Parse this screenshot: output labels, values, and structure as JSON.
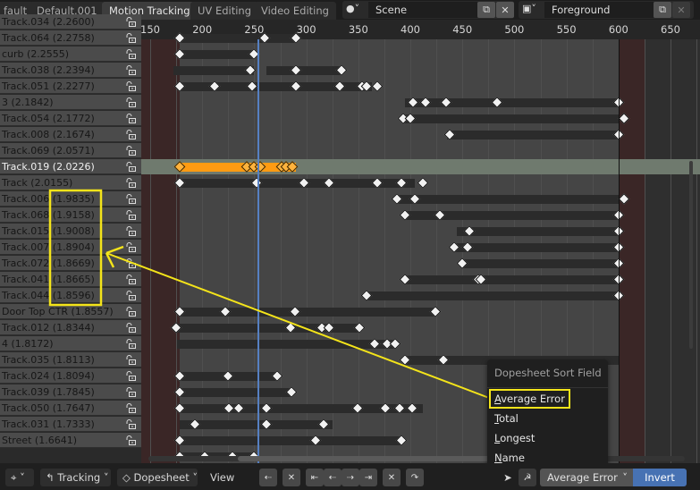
{
  "workspace_tabs": [
    {
      "label": "fault",
      "active": false
    },
    {
      "label": "Default.001",
      "active": false
    },
    {
      "label": "Motion Tracking",
      "active": true
    },
    {
      "label": "UV Editing",
      "active": false
    },
    {
      "label": "Video Editing",
      "active": false
    }
  ],
  "scene": {
    "icon": "scene-icon",
    "value": "Scene"
  },
  "view_layer": {
    "icon": "view-layer-icon",
    "value": "Foreground"
  },
  "timeline": {
    "ruler_ticks": [
      150,
      200,
      250,
      300,
      350,
      400,
      450,
      500,
      550,
      600,
      650
    ],
    "frame_start": 178,
    "frame_end": 600,
    "current_frame": 253
  },
  "tracks": [
    {
      "name": "Track.034 (2.2600)",
      "segments": [],
      "keys": [],
      "partial": true
    },
    {
      "name": "Track.064 (2.2758)",
      "segments": [
        [
          178,
          290
        ]
      ],
      "keys": [
        178,
        260,
        290
      ]
    },
    {
      "name": "curb (2.2555)",
      "segments": [
        [
          178,
          250
        ]
      ],
      "keys": [
        178,
        250
      ]
    },
    {
      "name": "Track.038 (2.2394)",
      "segments": [
        [
          172,
          250
        ],
        [
          262,
          334
        ]
      ],
      "keys": [
        246,
        290,
        334
      ]
    },
    {
      "name": "Track.051 (2.2277)",
      "segments": [
        [
          178,
          363
        ]
      ],
      "keys": [
        178,
        212,
        248,
        290,
        332,
        354,
        358,
        368
      ]
    },
    {
      "name": "3 (2.1842)",
      "segments": [
        [
          395,
          600
        ]
      ],
      "keys": [
        403,
        415,
        434,
        483,
        600
      ]
    },
    {
      "name": "Track.054 (2.1772)",
      "segments": [
        [
          393,
          600
        ]
      ],
      "keys": [
        393,
        400,
        605
      ]
    },
    {
      "name": "Track.008 (2.1674)",
      "segments": [
        [
          435,
          600
        ]
      ],
      "keys": [
        438,
        600
      ]
    },
    {
      "name": "Track.069 (2.0571)",
      "segments": [],
      "keys": []
    },
    {
      "name": "Track.019 (2.0226)",
      "selected": true,
      "segments": [
        [
          178,
          290
        ]
      ],
      "keys": [
        178,
        243,
        250,
        256,
        276,
        281,
        287
      ]
    },
    {
      "name": "Track (2.0155)",
      "segments": [
        [
          178,
          404
        ]
      ],
      "keys": [
        178,
        252,
        298,
        322,
        368,
        391,
        412
      ]
    },
    {
      "name": "Track.006 (1.9835)",
      "segments": [
        [
          387,
          600
        ]
      ],
      "keys": [
        387,
        404,
        605
      ]
    },
    {
      "name": "Track.068 (1.9158)",
      "segments": [
        [
          395,
          600
        ]
      ],
      "keys": [
        395,
        428,
        600
      ]
    },
    {
      "name": "Track.015 (1.9008)",
      "segments": [
        [
          445,
          600
        ]
      ],
      "keys": [
        457,
        600
      ]
    },
    {
      "name": "Track.007 (1.8904)",
      "segments": [
        [
          442,
          600
        ]
      ],
      "keys": [
        442,
        455,
        600
      ]
    },
    {
      "name": "Track.072 (1.8669)",
      "segments": [
        [
          450,
          600
        ]
      ],
      "keys": [
        450,
        600
      ]
    },
    {
      "name": "Track.041 (1.8665)",
      "segments": [
        [
          395,
          600
        ]
      ],
      "keys": [
        395,
        465,
        468,
        600
      ]
    },
    {
      "name": "Track.044 (1.8596)",
      "segments": [
        [
          358,
          600
        ]
      ],
      "keys": [
        358,
        600
      ]
    },
    {
      "name": "Door Top CTR (1.8557)",
      "segments": [
        [
          178,
          424
        ]
      ],
      "keys": [
        178,
        222,
        289,
        424
      ]
    },
    {
      "name": "Track.012 (1.8344)",
      "segments": [
        [
          175,
          351
        ]
      ],
      "keys": [
        175,
        285,
        315,
        322,
        351
      ]
    },
    {
      "name": "4 (1.8172)",
      "segments": [
        [
          176,
          386
        ]
      ],
      "keys": [
        366,
        378,
        385
      ]
    },
    {
      "name": "Track.035 (1.8113)",
      "segments": [
        [
          395,
          600
        ]
      ],
      "keys": [
        395,
        432
      ]
    },
    {
      "name": "Track.024 (1.8094)",
      "segments": [
        [
          178,
          272
        ]
      ],
      "keys": [
        178,
        225,
        272
      ]
    },
    {
      "name": "Track.039 (1.7845)",
      "segments": [
        [
          178,
          286
        ]
      ],
      "keys": [
        178,
        286
      ]
    },
    {
      "name": "Track.050 (1.7647)",
      "segments": [
        [
          178,
          412
        ]
      ],
      "keys": [
        178,
        226,
        235,
        262,
        349,
        376,
        390,
        402
      ]
    },
    {
      "name": "Track.031 (1.7333)",
      "segments": [
        [
          178,
          325
        ]
      ],
      "keys": [
        193,
        262,
        317
      ]
    },
    {
      "name": "Street (1.6641)",
      "segments": [
        [
          178,
          391
        ]
      ],
      "keys": [
        178,
        309,
        391
      ]
    },
    {
      "name": "",
      "segments": [
        [
          178,
          250
        ]
      ],
      "keys": [
        178,
        202,
        229,
        250
      ]
    }
  ],
  "popup": {
    "title": "Dopesheet Sort Field",
    "items": [
      {
        "label": "Average Error",
        "underline": "A",
        "rest": "verage Error",
        "highlighted": true
      },
      {
        "label": "Total",
        "underline": "T",
        "rest": "otal"
      },
      {
        "label": "Longest",
        "underline": "L",
        "rest": "ongest"
      },
      {
        "label": "Name",
        "underline": "N",
        "rest": "ame"
      }
    ]
  },
  "bottombar": {
    "pivot_icon": "pivot-icon",
    "mode_label": "Tracking",
    "view_type_label": "Dopesheet",
    "view_menu": "View",
    "sort_field": "Average Error",
    "invert_label": "Invert"
  },
  "annotation": {
    "color": "#f4e41a"
  }
}
